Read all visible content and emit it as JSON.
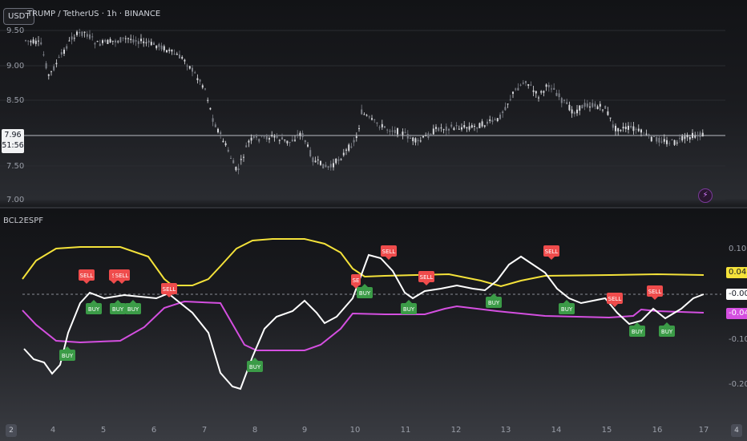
{
  "header": {
    "quote_badge": "USDT",
    "symbol_title": "TRUMP / TetherUS · 1h · BINANCE"
  },
  "price_pane": {
    "y_ticks": [
      "9.50",
      "9.00",
      "8.50",
      "7.50",
      "7.00"
    ],
    "current_price": "7.96",
    "countdown": "51:56",
    "price_line_color": "#b9bcc3"
  },
  "indicator_pane": {
    "title": "BCL2ESPF",
    "y_ticks": [
      "0.10",
      "-0.10",
      "-0.20"
    ],
    "labels": {
      "upper": "0.04",
      "zero": "-0.00",
      "lower": "-0.04"
    },
    "colors": {
      "upper": "#f4e23a",
      "lower": "#d44fe0",
      "main": "#ffffff",
      "buy": "#3b9b47",
      "sell": "#ef4c4c"
    },
    "signals": [
      {
        "type": "BUY",
        "label": "BUY"
      },
      {
        "type": "SELL",
        "label": "SELL"
      },
      {
        "type": "BUY",
        "label": "BUY"
      },
      {
        "type": "SELL",
        "label": "S"
      },
      {
        "type": "SELL",
        "label": "SELL"
      },
      {
        "type": "BUY",
        "label": "BUY"
      },
      {
        "type": "BUY",
        "label": "BUY"
      },
      {
        "type": "SELL",
        "label": "SELL"
      },
      {
        "type": "BUY",
        "label": "BUY"
      },
      {
        "type": "SELL",
        "label": "SE"
      },
      {
        "type": "BUY",
        "label": "BUY"
      },
      {
        "type": "SELL",
        "label": "SELL"
      },
      {
        "type": "BUY",
        "label": "BUY"
      },
      {
        "type": "SELL",
        "label": "SELL"
      },
      {
        "type": "BUY",
        "label": "BUY"
      },
      {
        "type": "SELL",
        "label": "SELL"
      },
      {
        "type": "BUY",
        "label": "BUY"
      },
      {
        "type": "SELL",
        "label": "SELL"
      },
      {
        "type": "BUY",
        "label": "BUY"
      },
      {
        "type": "SELL",
        "label": "SELL"
      },
      {
        "type": "BUY",
        "label": "BUY"
      }
    ]
  },
  "time_axis": {
    "ticks": [
      "4",
      "5",
      "6",
      "7",
      "8",
      "9",
      "10",
      "11",
      "12",
      "13",
      "14",
      "15",
      "16",
      "17"
    ]
  },
  "nav": {
    "left_label": "2",
    "right_label": "4"
  }
}
